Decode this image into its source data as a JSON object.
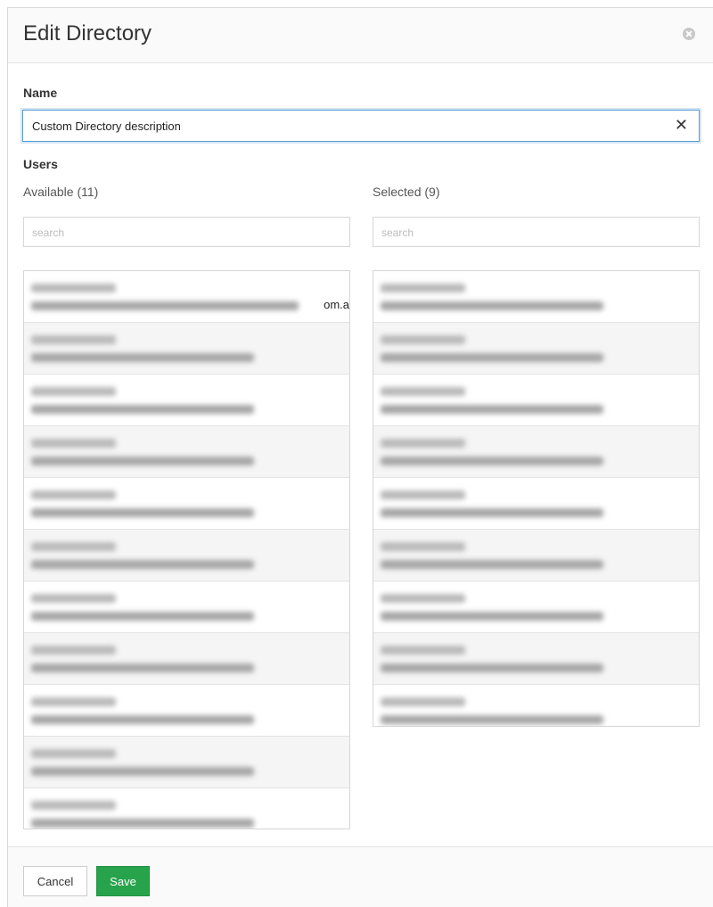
{
  "dialog": {
    "title": "Edit Directory"
  },
  "name_field": {
    "label": "Name",
    "value": "Custom Directory description",
    "clear_symbol": "✕"
  },
  "users": {
    "label": "Users",
    "available": {
      "label": "Available (11)",
      "search_placeholder": "search",
      "partial_text": "om.a",
      "row_count": 11
    },
    "selected": {
      "label": "Selected (9)",
      "search_placeholder": "search",
      "row_count": 9
    }
  },
  "footer": {
    "cancel_label": "Cancel",
    "save_label": "Save"
  },
  "colors": {
    "save_button": "#27a34c",
    "focus_border": "#5b9bd5"
  }
}
